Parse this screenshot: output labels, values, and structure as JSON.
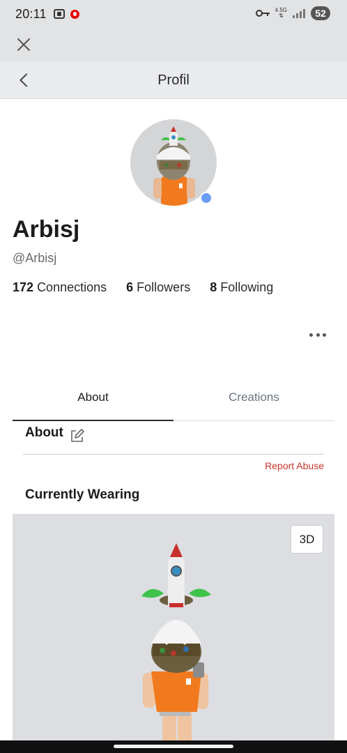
{
  "status_bar": {
    "time": "20:11",
    "network_type": "4.5G",
    "battery": "52"
  },
  "header": {
    "title": "Profil"
  },
  "profile": {
    "display_name": "Arbisj",
    "username": "@Arbisj",
    "online_status_color": "#6a9df5",
    "stats": [
      {
        "count": "172",
        "label": "Connections"
      },
      {
        "count": "6",
        "label": "Followers"
      },
      {
        "count": "8",
        "label": "Following"
      }
    ]
  },
  "tabs": [
    {
      "label": "About",
      "active": true
    },
    {
      "label": "Creations",
      "active": false
    }
  ],
  "about": {
    "heading": "About",
    "report_label": "Report Abuse",
    "report_color": "#c8372d"
  },
  "wearing": {
    "heading": "Currently Wearing",
    "view_3d_label": "3D"
  }
}
